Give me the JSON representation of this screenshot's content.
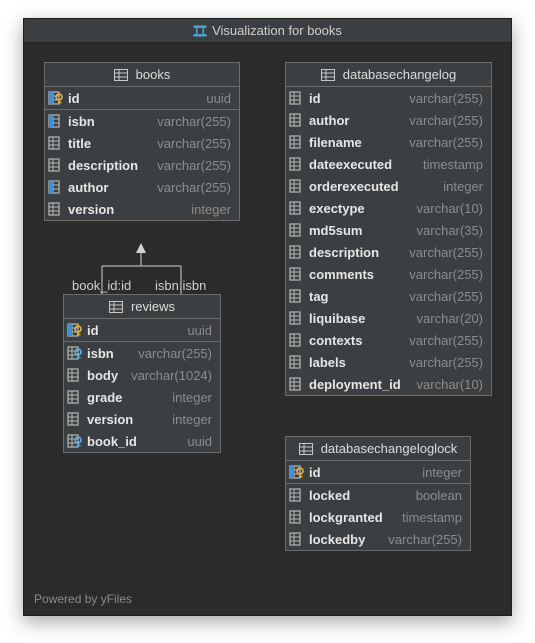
{
  "window": {
    "title": "Visualization for books",
    "footer": "Powered by yFiles"
  },
  "relations": [
    {
      "label_left": "book_id:id",
      "label_right": "isbn:isbn",
      "from": "reviews",
      "to": "books"
    }
  ],
  "tables": {
    "books": {
      "name": "books",
      "pk": [
        {
          "name": "id",
          "type": "uuid",
          "icon": "key-column-icon"
        }
      ],
      "columns": [
        {
          "name": "isbn",
          "type": "varchar(255)",
          "icon": "index-column-icon"
        },
        {
          "name": "title",
          "type": "varchar(255)",
          "icon": "column-icon"
        },
        {
          "name": "description",
          "type": "varchar(255)",
          "icon": "column-icon"
        },
        {
          "name": "author",
          "type": "varchar(255)",
          "icon": "index-column-icon"
        },
        {
          "name": "version",
          "type": "integer",
          "icon": "column-icon"
        }
      ]
    },
    "databasechangelog": {
      "name": "databasechangelog",
      "pk": [],
      "columns": [
        {
          "name": "id",
          "type": "varchar(255)",
          "icon": "column-icon"
        },
        {
          "name": "author",
          "type": "varchar(255)",
          "icon": "column-icon"
        },
        {
          "name": "filename",
          "type": "varchar(255)",
          "icon": "column-icon"
        },
        {
          "name": "dateexecuted",
          "type": "timestamp",
          "icon": "column-icon"
        },
        {
          "name": "orderexecuted",
          "type": "integer",
          "icon": "column-icon"
        },
        {
          "name": "exectype",
          "type": "varchar(10)",
          "icon": "column-icon"
        },
        {
          "name": "md5sum",
          "type": "varchar(35)",
          "icon": "column-icon"
        },
        {
          "name": "description",
          "type": "varchar(255)",
          "icon": "column-icon"
        },
        {
          "name": "comments",
          "type": "varchar(255)",
          "icon": "column-icon"
        },
        {
          "name": "tag",
          "type": "varchar(255)",
          "icon": "column-icon"
        },
        {
          "name": "liquibase",
          "type": "varchar(20)",
          "icon": "column-icon"
        },
        {
          "name": "contexts",
          "type": "varchar(255)",
          "icon": "column-icon"
        },
        {
          "name": "labels",
          "type": "varchar(255)",
          "icon": "column-icon"
        },
        {
          "name": "deployment_id",
          "type": "varchar(10)",
          "icon": "column-icon"
        }
      ]
    },
    "reviews": {
      "name": "reviews",
      "pk": [
        {
          "name": "id",
          "type": "uuid",
          "icon": "key-column-icon"
        }
      ],
      "columns": [
        {
          "name": "isbn",
          "type": "varchar(255)",
          "icon": "foreign-key-column-icon"
        },
        {
          "name": "body",
          "type": "varchar(1024)",
          "icon": "column-icon"
        },
        {
          "name": "grade",
          "type": "integer",
          "icon": "column-icon"
        },
        {
          "name": "version",
          "type": "integer",
          "icon": "column-icon"
        },
        {
          "name": "book_id",
          "type": "uuid",
          "icon": "foreign-key-column-icon"
        }
      ]
    },
    "databasechangeloglock": {
      "name": "databasechangeloglock",
      "pk": [
        {
          "name": "id",
          "type": "integer",
          "icon": "key-column-icon"
        }
      ],
      "columns": [
        {
          "name": "locked",
          "type": "boolean",
          "icon": "column-icon"
        },
        {
          "name": "lockgranted",
          "type": "timestamp",
          "icon": "column-icon"
        },
        {
          "name": "lockedby",
          "type": "varchar(255)",
          "icon": "column-icon"
        }
      ]
    }
  }
}
